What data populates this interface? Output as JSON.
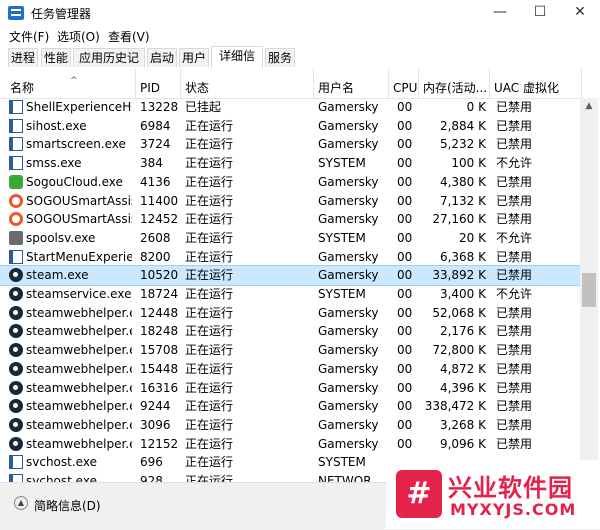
{
  "window": {
    "title": "任务管理器",
    "minimize": "—",
    "maximize": "☐",
    "close": "✕"
  },
  "menu": [
    "文件(F)",
    "选项(O)",
    "查看(V)"
  ],
  "tabs": [
    "进程",
    "性能",
    "应用历史记录",
    "启动",
    "用户",
    "详细信息",
    "服务"
  ],
  "active_tab": "详细信息",
  "columns": {
    "name": "名称",
    "pid": "PID",
    "status": "状态",
    "user": "用户名",
    "cpu": "CPU",
    "memory": "内存(活动...",
    "uac": "UAC 虚拟化"
  },
  "sort_indicator": "^",
  "rows": [
    {
      "icon": "window",
      "name": "ShellExperienceHo...",
      "pid": "13228",
      "status": "已挂起",
      "user": "Gamersky",
      "cpu": "00",
      "memory": "0 K",
      "uac": "已禁用"
    },
    {
      "icon": "window",
      "name": "sihost.exe",
      "pid": "6984",
      "status": "正在运行",
      "user": "Gamersky",
      "cpu": "00",
      "memory": "2,884 K",
      "uac": "已禁用"
    },
    {
      "icon": "window",
      "name": "smartscreen.exe",
      "pid": "3724",
      "status": "正在运行",
      "user": "Gamersky",
      "cpu": "00",
      "memory": "5,232 K",
      "uac": "已禁用"
    },
    {
      "icon": "window",
      "name": "smss.exe",
      "pid": "384",
      "status": "正在运行",
      "user": "SYSTEM",
      "cpu": "00",
      "memory": "100 K",
      "uac": "不允许"
    },
    {
      "icon": "sogou-cloud",
      "name": "SogouCloud.exe",
      "pid": "4136",
      "status": "正在运行",
      "user": "Gamersky",
      "cpu": "00",
      "memory": "4,380 K",
      "uac": "已禁用"
    },
    {
      "icon": "sogou-smart",
      "name": "SOGOUSmartAssis...",
      "pid": "11400",
      "status": "正在运行",
      "user": "Gamersky",
      "cpu": "00",
      "memory": "7,132 K",
      "uac": "已禁用"
    },
    {
      "icon": "sogou-smart",
      "name": "SOGOUSmartAssis...",
      "pid": "12452",
      "status": "正在运行",
      "user": "Gamersky",
      "cpu": "00",
      "memory": "27,160 K",
      "uac": "已禁用"
    },
    {
      "icon": "printer",
      "name": "spoolsv.exe",
      "pid": "2608",
      "status": "正在运行",
      "user": "SYSTEM",
      "cpu": "00",
      "memory": "20 K",
      "uac": "不允许"
    },
    {
      "icon": "window",
      "name": "StartMenuExperien...",
      "pid": "8200",
      "status": "正在运行",
      "user": "Gamersky",
      "cpu": "00",
      "memory": "6,368 K",
      "uac": "已禁用"
    },
    {
      "icon": "steam",
      "name": "steam.exe",
      "pid": "10520",
      "status": "正在运行",
      "user": "Gamersky",
      "cpu": "00",
      "memory": "33,892 K",
      "uac": "已禁用",
      "selected": true
    },
    {
      "icon": "steam",
      "name": "steamservice.exe",
      "pid": "18724",
      "status": "正在运行",
      "user": "SYSTEM",
      "cpu": "00",
      "memory": "3,400 K",
      "uac": "不允许"
    },
    {
      "icon": "steam",
      "name": "steamwebhelper.exe",
      "pid": "12448",
      "status": "正在运行",
      "user": "Gamersky",
      "cpu": "00",
      "memory": "52,068 K",
      "uac": "已禁用"
    },
    {
      "icon": "steam",
      "name": "steamwebhelper.exe",
      "pid": "18248",
      "status": "正在运行",
      "user": "Gamersky",
      "cpu": "00",
      "memory": "2,176 K",
      "uac": "已禁用"
    },
    {
      "icon": "steam",
      "name": "steamwebhelper.exe",
      "pid": "15708",
      "status": "正在运行",
      "user": "Gamersky",
      "cpu": "00",
      "memory": "72,800 K",
      "uac": "已禁用"
    },
    {
      "icon": "steam",
      "name": "steamwebhelper.exe",
      "pid": "15448",
      "status": "正在运行",
      "user": "Gamersky",
      "cpu": "00",
      "memory": "4,872 K",
      "uac": "已禁用"
    },
    {
      "icon": "steam",
      "name": "steamwebhelper.exe",
      "pid": "16316",
      "status": "正在运行",
      "user": "Gamersky",
      "cpu": "00",
      "memory": "4,396 K",
      "uac": "已禁用"
    },
    {
      "icon": "steam",
      "name": "steamwebhelper.exe",
      "pid": "9244",
      "status": "正在运行",
      "user": "Gamersky",
      "cpu": "00",
      "memory": "338,472 K",
      "uac": "已禁用"
    },
    {
      "icon": "steam",
      "name": "steamwebhelper.exe",
      "pid": "3096",
      "status": "正在运行",
      "user": "Gamersky",
      "cpu": "00",
      "memory": "3,268 K",
      "uac": "已禁用"
    },
    {
      "icon": "steam",
      "name": "steamwebhelper.exe",
      "pid": "12152",
      "status": "正在运行",
      "user": "Gamersky",
      "cpu": "00",
      "memory": "9,096 K",
      "uac": "已禁用"
    },
    {
      "icon": "window",
      "name": "svchost.exe",
      "pid": "696",
      "status": "正在运行",
      "user": "SYSTEM",
      "cpu": "",
      "memory": "",
      "uac": ""
    },
    {
      "icon": "window",
      "name": "svchost.exe",
      "pid": "928",
      "status": "正在运行",
      "user": "NETWOR",
      "cpu": "",
      "memory": "",
      "uac": ""
    }
  ],
  "footer": {
    "label": "简略信息(D)"
  },
  "watermark": {
    "title": "兴业软件园",
    "subtitle": "MYXYJS.COM",
    "logo": "#"
  },
  "colors": {
    "selection": "#cce8ff",
    "watermark": "#e5234a",
    "steam_icon": "#1b2838"
  }
}
